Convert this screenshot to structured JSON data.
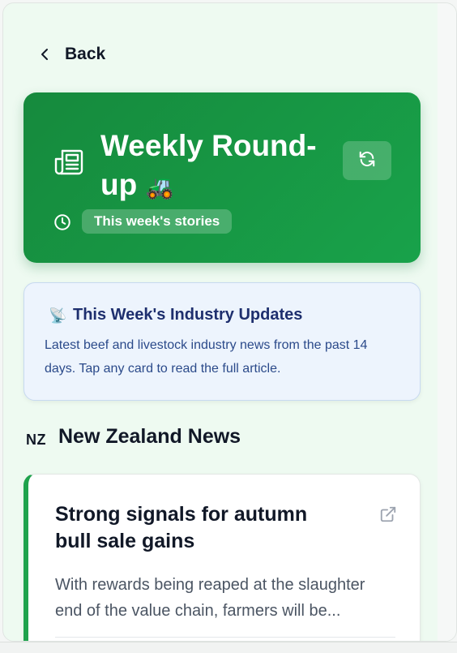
{
  "nav": {
    "back_label": "Back"
  },
  "hero": {
    "title": "Weekly Round-up",
    "title_emoji": "🚜",
    "tag": "This week's stories",
    "colors": {
      "gradient_start": "#168a3d",
      "gradient_end": "#18a24a"
    },
    "icons": {
      "main": "newspaper-icon",
      "refresh": "refresh-icon",
      "clock": "clock-icon"
    }
  },
  "info": {
    "icon": "📡",
    "title": "This Week's Industry Updates",
    "body": "Latest beef and livestock industry news from the past 14 days. Tap any card to read the full article."
  },
  "section": {
    "flag": "NZ",
    "title": "New Zealand News"
  },
  "articles": [
    {
      "title": "Strong signals for autumn bull sale gains",
      "summary": "With rewards being reaped at the slaughter end of the value chain, farmers will be...",
      "icon": "external-link-icon",
      "accent": "#1fa24c"
    }
  ]
}
